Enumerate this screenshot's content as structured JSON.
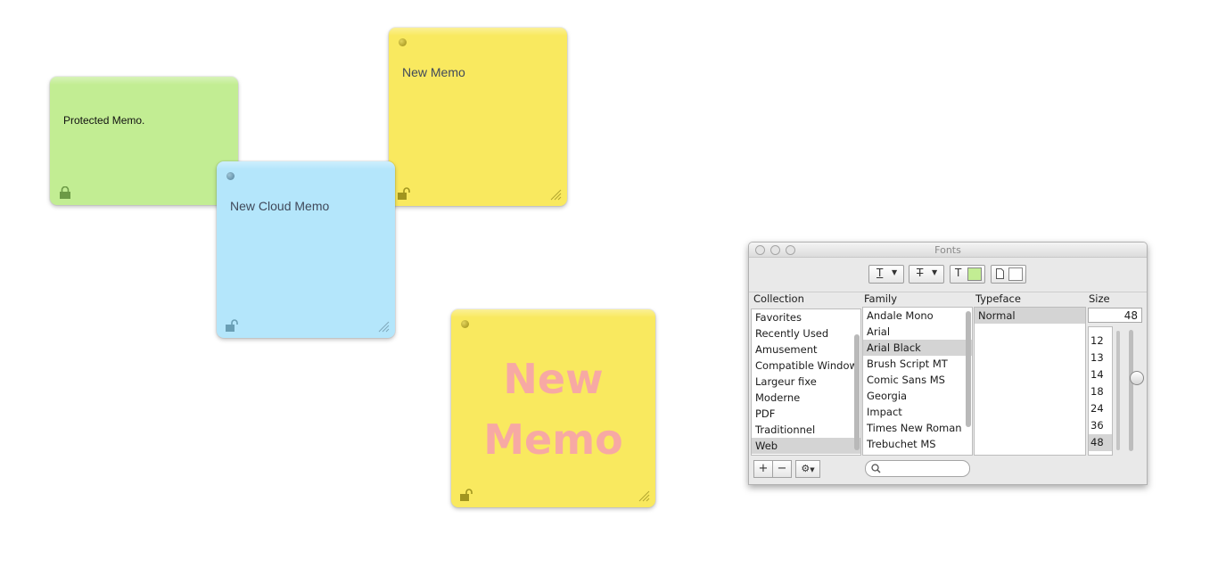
{
  "memos": {
    "green": {
      "text": "Protected Memo.",
      "locked": true,
      "color": "#c2ed93"
    },
    "blue": {
      "text": "New Cloud Memo",
      "locked": false,
      "color": "#b4e6fb"
    },
    "yellow_top": {
      "text": "New Memo",
      "locked": false,
      "color": "#f9e95f"
    },
    "yellow_big": {
      "text": "New\nMemo",
      "text_color": "#f7a9a4",
      "locked": false,
      "color": "#f9e95f"
    }
  },
  "fonts_panel": {
    "title": "Fonts",
    "columns": {
      "collection": "Collection",
      "family": "Family",
      "typeface": "Typeface",
      "size": "Size"
    },
    "collections": [
      "Favorites",
      "Recently Used",
      "Amusement",
      "Compatible Window",
      "Largeur fixe",
      "Moderne",
      "PDF",
      "Traditionnel",
      "Web"
    ],
    "selected_collection": "Web",
    "families": [
      "Andale Mono",
      "Arial",
      "Arial Black",
      "Brush Script MT",
      "Comic Sans MS",
      "Georgia",
      "Impact",
      "Times New Roman",
      "Trebuchet MS"
    ],
    "selected_family": "Arial Black",
    "typefaces": [
      "Normal"
    ],
    "selected_typeface": "Normal",
    "size_value": "48",
    "sizes": [
      "12",
      "13",
      "14",
      "18",
      "24",
      "36",
      "48"
    ],
    "selected_size": "48",
    "text_color": "#c2ed93",
    "doc_color": "#ffffff",
    "buttons": {
      "add": "+",
      "remove": "−"
    },
    "search_placeholder": ""
  }
}
